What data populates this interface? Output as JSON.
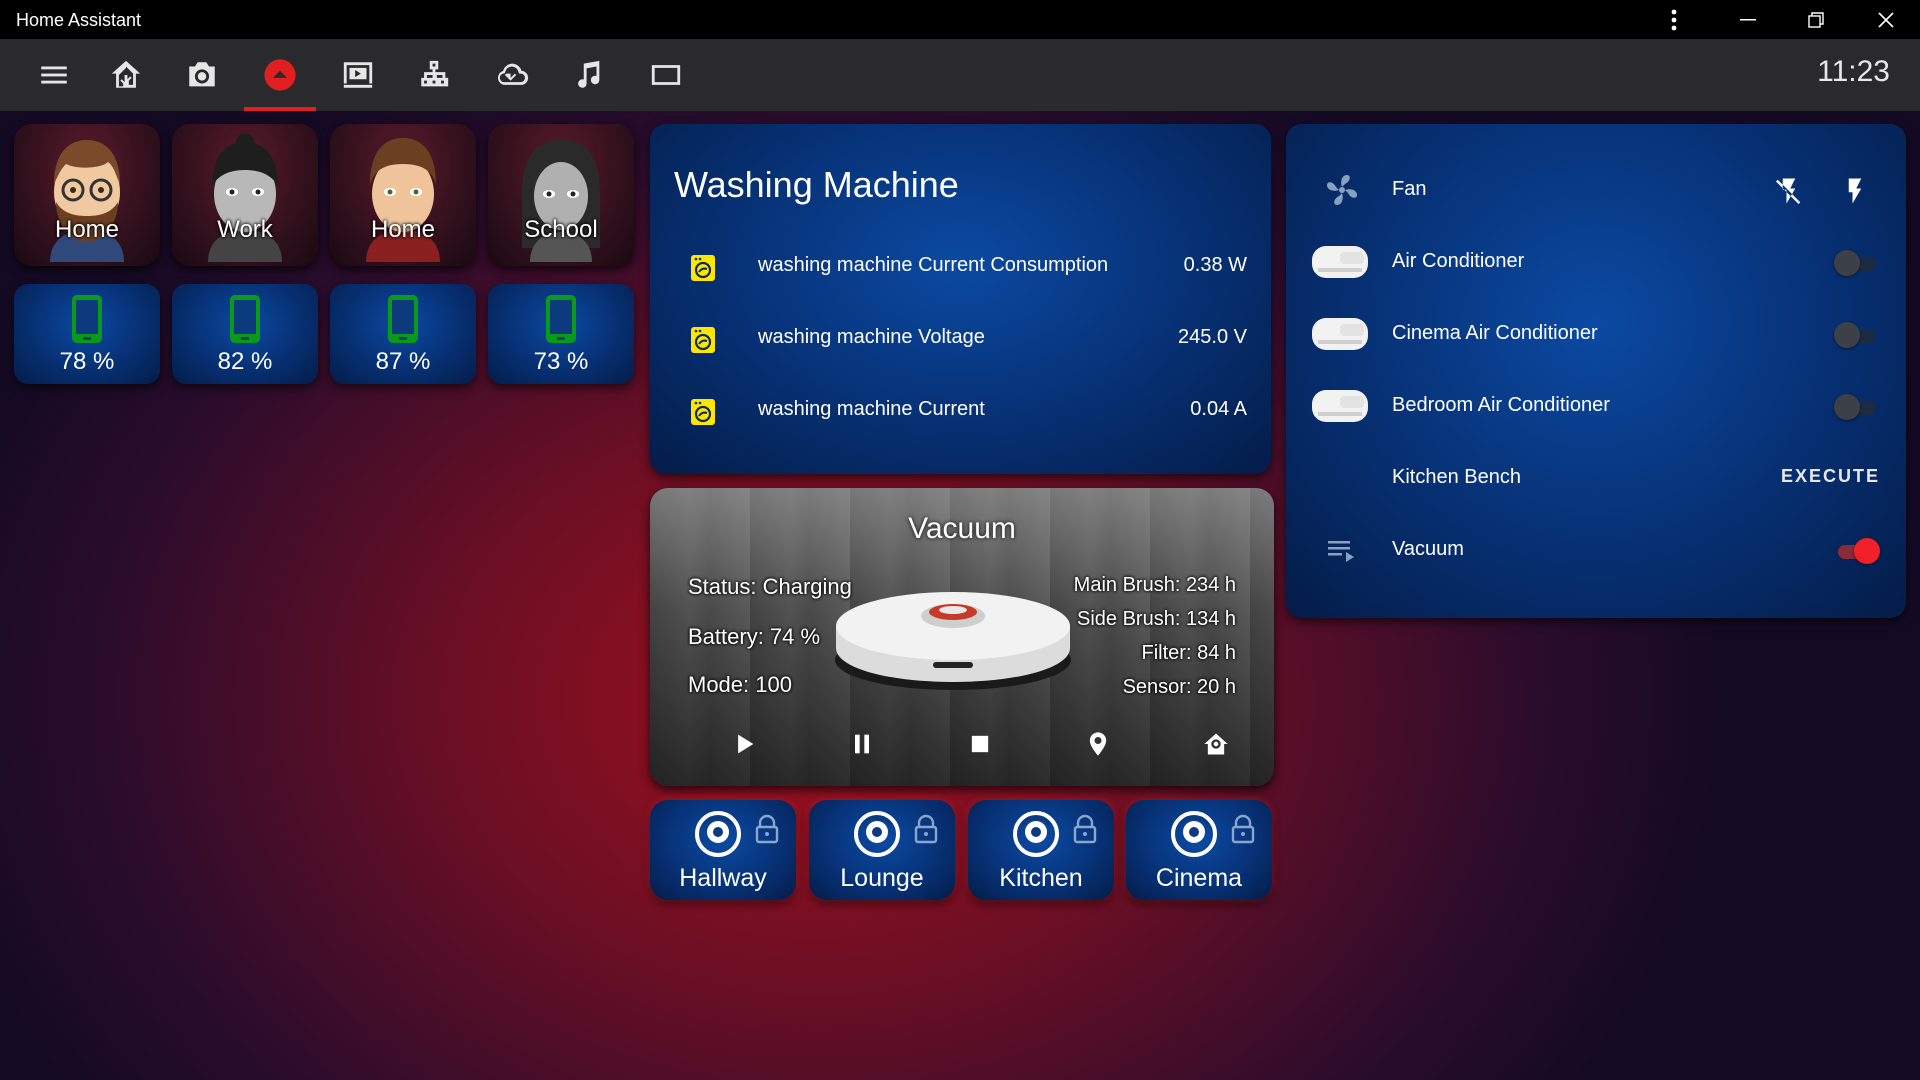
{
  "window": {
    "title": "Home Assistant",
    "menu_icon": "more-vert-icon",
    "minimize_icon": "minimize-icon",
    "restore_icon": "restore-icon",
    "close_icon": "close-icon"
  },
  "toolbar": {
    "icons": [
      "menu-icon",
      "home-assistant-icon",
      "camera-icon",
      "vacuum-tab-icon",
      "media-icon",
      "network-icon",
      "cloud-sync-icon",
      "music-icon",
      "screen-icon"
    ],
    "active_index": 3,
    "accent": "#e02020",
    "clock": "11:23"
  },
  "people": [
    {
      "location": "Home"
    },
    {
      "location": "Work"
    },
    {
      "location": "Home"
    },
    {
      "location": "School"
    }
  ],
  "batteries": [
    {
      "value": "78 %"
    },
    {
      "value": "82 %"
    },
    {
      "value": "87 %"
    },
    {
      "value": "73 %"
    }
  ],
  "washer": {
    "title": "Washing Machine",
    "rows": [
      {
        "label": "washing machine Current Consumption",
        "value": "0.38 W"
      },
      {
        "label": "washing machine Voltage",
        "value": "245.0 V"
      },
      {
        "label": "washing machine Current",
        "value": "0.04 A"
      }
    ],
    "icon_color": "#ffe600"
  },
  "vacuum": {
    "title": "Vacuum",
    "status": "Status: Charging",
    "battery": "Battery: 74 %",
    "mode": "Mode: 100",
    "main_brush": "Main Brush: 234 h",
    "side_brush": "Side Brush: 134 h",
    "filter": "Filter: 84 h",
    "sensor": "Sensor: 20 h",
    "controls": [
      "play-icon",
      "pause-icon",
      "stop-icon",
      "locate-icon",
      "return-home-icon"
    ]
  },
  "rooms": [
    {
      "label": "Hallway"
    },
    {
      "label": "Lounge"
    },
    {
      "label": "Kitchen"
    },
    {
      "label": "Cinema"
    }
  ],
  "entities": {
    "fan": {
      "label": "Fan"
    },
    "ac": {
      "label": "Air Conditioner",
      "state": "off"
    },
    "cinema_ac": {
      "label": "Cinema Air Conditioner",
      "state": "off"
    },
    "bedroom_ac": {
      "label": "Bedroom Air Conditioner",
      "state": "off"
    },
    "kitchen_bench": {
      "label": "Kitchen Bench",
      "action": "EXECUTE"
    },
    "vacuum": {
      "label": "Vacuum",
      "state": "on"
    }
  }
}
